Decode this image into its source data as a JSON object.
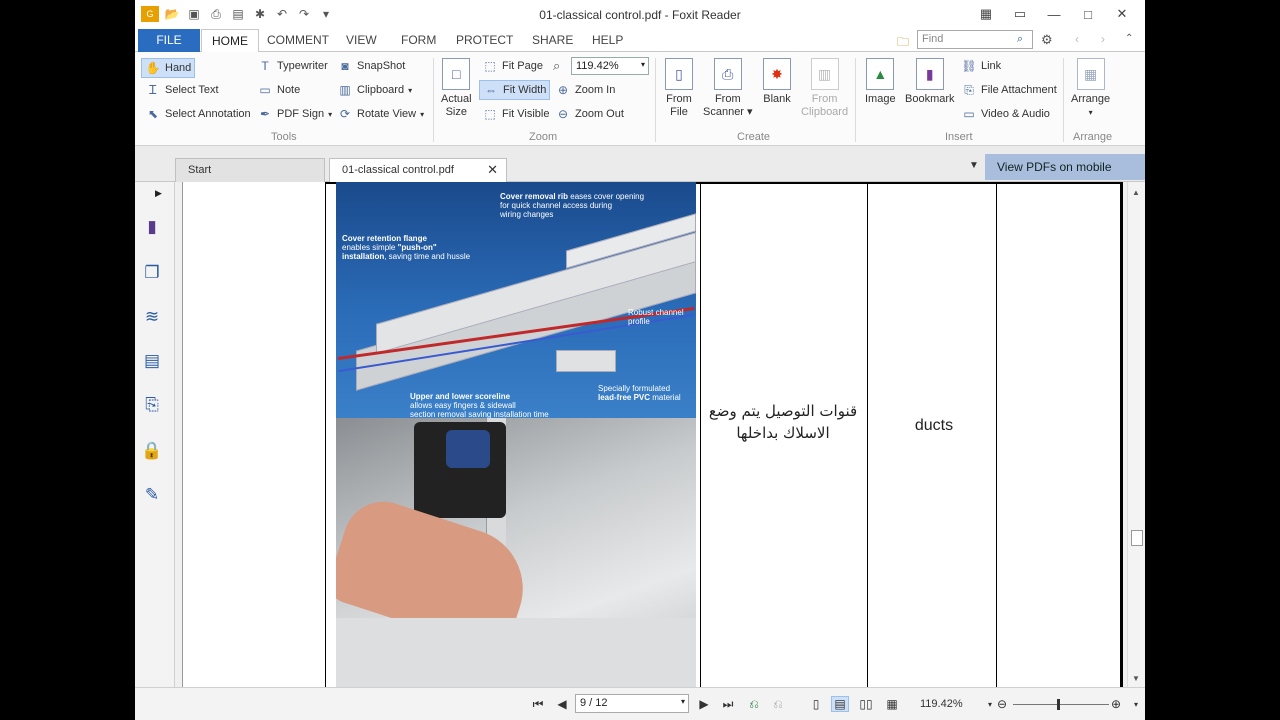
{
  "window": {
    "title": "01-classical control.pdf - Foxit Reader"
  },
  "menu": {
    "tabs": [
      "FILE",
      "HOME",
      "COMMENT",
      "VIEW",
      "FORM",
      "PROTECT",
      "SHARE",
      "HELP"
    ],
    "active": "HOME",
    "find_placeholder": "Find"
  },
  "ribbon": {
    "tools": {
      "label": "Tools",
      "hand": "Hand",
      "select_text": "Select Text",
      "select_annotation": "Select Annotation",
      "typewriter": "Typewriter",
      "note": "Note",
      "pdf_sign": "PDF Sign",
      "snapshot": "SnapShot",
      "clipboard": "Clipboard",
      "rotate_view": "Rotate View"
    },
    "zoom": {
      "label": "Zoom",
      "actual_size_1": "Actual",
      "actual_size_2": "Size",
      "fit_page": "Fit Page",
      "fit_width": "Fit Width",
      "fit_visible": "Fit Visible",
      "zoom_value": "119.42%",
      "zoom_in": "Zoom In",
      "zoom_out": "Zoom Out"
    },
    "create": {
      "label": "Create",
      "from_file_1": "From",
      "from_file_2": "File",
      "from_scanner_1": "From",
      "from_scanner_2": "Scanner",
      "blank": "Blank",
      "from_clipboard_1": "From",
      "from_clipboard_2": "Clipboard"
    },
    "insert": {
      "label": "Insert",
      "image": "Image",
      "bookmark": "Bookmark",
      "link": "Link",
      "file_attachment": "File Attachment",
      "video_audio": "Video & Audio"
    },
    "arrange": {
      "label": "Arrange",
      "arrange": "Arrange"
    }
  },
  "doctabs": {
    "start": "Start",
    "current": "01-classical control.pdf",
    "mobile_banner": "View PDFs on mobile devices"
  },
  "document": {
    "arabic_text": "قنوات التوصيل يتم وضع الاسلاك بداخلها",
    "english_text": "ducts",
    "captions": {
      "c1a": "Cover removal rib",
      "c1b": " eases cover opening",
      "c1c": "for quick channel access during",
      "c1d": "wiring changes",
      "c2a": "Cover retention flange",
      "c2b": "enables simple ",
      "c2c": "\"push-on\"",
      "c2d": "installation",
      "c2e": ", saving time and hussle",
      "c3a": "Robust channel",
      "c3b": "profile",
      "c4a": "Upper and lower scoreline",
      "c4b": "allows easy fingers & sidewall",
      "c4c": "section removal saving installation time",
      "c5a": "Specially formulated",
      "c5b": "lead-free PVC",
      "c5c": " material"
    }
  },
  "statusbar": {
    "page_value": "9 / 12",
    "zoom_value": "119.42%"
  },
  "colors": {
    "accent": "#2a6cbf",
    "banner": "#a8bedc",
    "selected": "#cde0f7"
  }
}
